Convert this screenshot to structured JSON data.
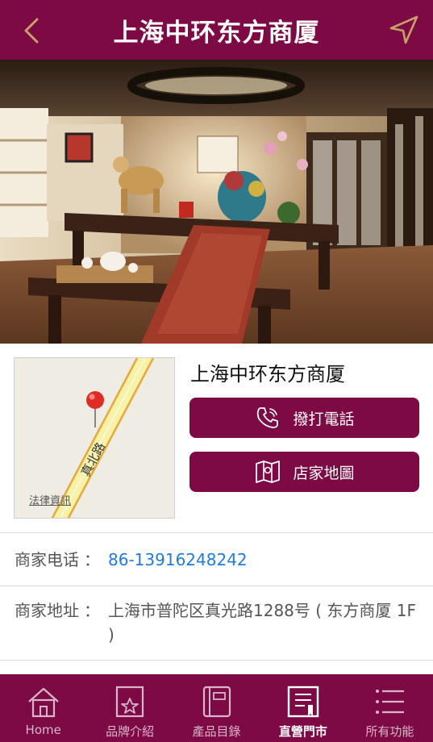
{
  "header": {
    "title": "上海中环东方商厦"
  },
  "store": {
    "name": "上海中环东方商厦",
    "call_label": "撥打電話",
    "map_label": "店家地圖"
  },
  "map": {
    "street_label": "真北路",
    "legal_label": "法律資訊"
  },
  "details": {
    "phone_label": "商家电话",
    "phone_sep": "：",
    "phone_value": "86-13916248242",
    "address_label": "商家地址",
    "address_sep": "：",
    "address_value": "上海市普陀区真光路1288号 ( 东方商厦 1F )"
  },
  "tabs": [
    {
      "label": "Home",
      "icon": "home-icon",
      "active": false
    },
    {
      "label": "品牌介紹",
      "icon": "star-card-icon",
      "active": false
    },
    {
      "label": "產品目錄",
      "icon": "catalog-icon",
      "active": false
    },
    {
      "label": "直營門市",
      "icon": "store-doc-icon",
      "active": true
    },
    {
      "label": "所有功能",
      "icon": "menu-lines-icon",
      "active": false
    }
  ],
  "colors": {
    "brand": "#7d0a45",
    "link": "#1e7be0",
    "icon_gold": "#c8a06a"
  }
}
